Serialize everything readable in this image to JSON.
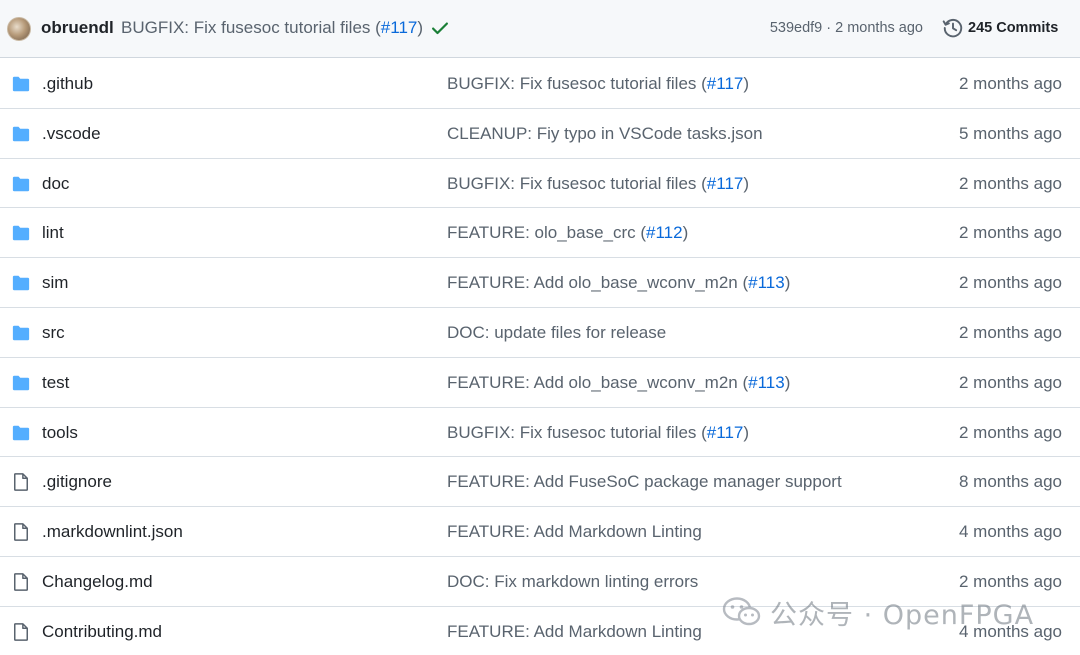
{
  "latest_commit": {
    "author": "obruendl",
    "message_prefix": "BUGFIX: Fix fusesoc tutorial files (",
    "message_pr": "#117",
    "message_suffix": ")",
    "sha": "539edf9",
    "separator": " · ",
    "age": "2 months ago",
    "commits_label": "245 Commits",
    "status_color": "#1a7f37"
  },
  "colors": {
    "folder": "#54aeff",
    "link": "#0969da",
    "muted": "#59636e"
  },
  "entries": [
    {
      "type": "folder",
      "icon": "folder-icon",
      "name": ".github",
      "msg_prefix": "BUGFIX: Fix fusesoc tutorial files (",
      "msg_pr": "#117",
      "msg_suffix": ")",
      "age": "2 months ago"
    },
    {
      "type": "folder",
      "icon": "folder-icon",
      "name": ".vscode",
      "msg_prefix": "CLEANUP: Fiy typo in VSCode tasks.json",
      "msg_pr": "",
      "msg_suffix": "",
      "age": "5 months ago"
    },
    {
      "type": "folder",
      "icon": "folder-icon",
      "name": "doc",
      "msg_prefix": "BUGFIX: Fix fusesoc tutorial files (",
      "msg_pr": "#117",
      "msg_suffix": ")",
      "age": "2 months ago"
    },
    {
      "type": "folder",
      "icon": "folder-icon",
      "name": "lint",
      "msg_prefix": "FEATURE: olo_base_crc (",
      "msg_pr": "#112",
      "msg_suffix": ")",
      "age": "2 months ago"
    },
    {
      "type": "folder",
      "icon": "folder-icon",
      "name": "sim",
      "msg_prefix": "FEATURE: Add olo_base_wconv_m2n (",
      "msg_pr": "#113",
      "msg_suffix": ")",
      "age": "2 months ago"
    },
    {
      "type": "folder",
      "icon": "folder-icon",
      "name": "src",
      "msg_prefix": "DOC: update files for release",
      "msg_pr": "",
      "msg_suffix": "",
      "age": "2 months ago"
    },
    {
      "type": "folder",
      "icon": "folder-icon",
      "name": "test",
      "msg_prefix": "FEATURE: Add olo_base_wconv_m2n (",
      "msg_pr": "#113",
      "msg_suffix": ")",
      "age": "2 months ago"
    },
    {
      "type": "folder",
      "icon": "folder-icon",
      "name": "tools",
      "msg_prefix": "BUGFIX: Fix fusesoc tutorial files (",
      "msg_pr": "#117",
      "msg_suffix": ")",
      "age": "2 months ago"
    },
    {
      "type": "file",
      "icon": "file-icon",
      "name": ".gitignore",
      "msg_prefix": "FEATURE: Add FuseSoC package manager support",
      "msg_pr": "",
      "msg_suffix": "",
      "age": "8 months ago"
    },
    {
      "type": "file",
      "icon": "file-icon",
      "name": ".markdownlint.json",
      "msg_prefix": "FEATURE: Add Markdown Linting",
      "msg_pr": "",
      "msg_suffix": "",
      "age": "4 months ago"
    },
    {
      "type": "file",
      "icon": "file-icon",
      "name": "Changelog.md",
      "msg_prefix": "DOC: Fix markdown linting errors",
      "msg_pr": "",
      "msg_suffix": "",
      "age": "2 months ago"
    },
    {
      "type": "file",
      "icon": "file-icon",
      "name": "Contributing.md",
      "msg_prefix": "FEATURE: Add Markdown Linting",
      "msg_pr": "",
      "msg_suffix": "",
      "age": "4 months ago"
    }
  ],
  "watermark": {
    "text": "公众号 · OpenFPGA",
    "icon": "wechat-icon"
  }
}
